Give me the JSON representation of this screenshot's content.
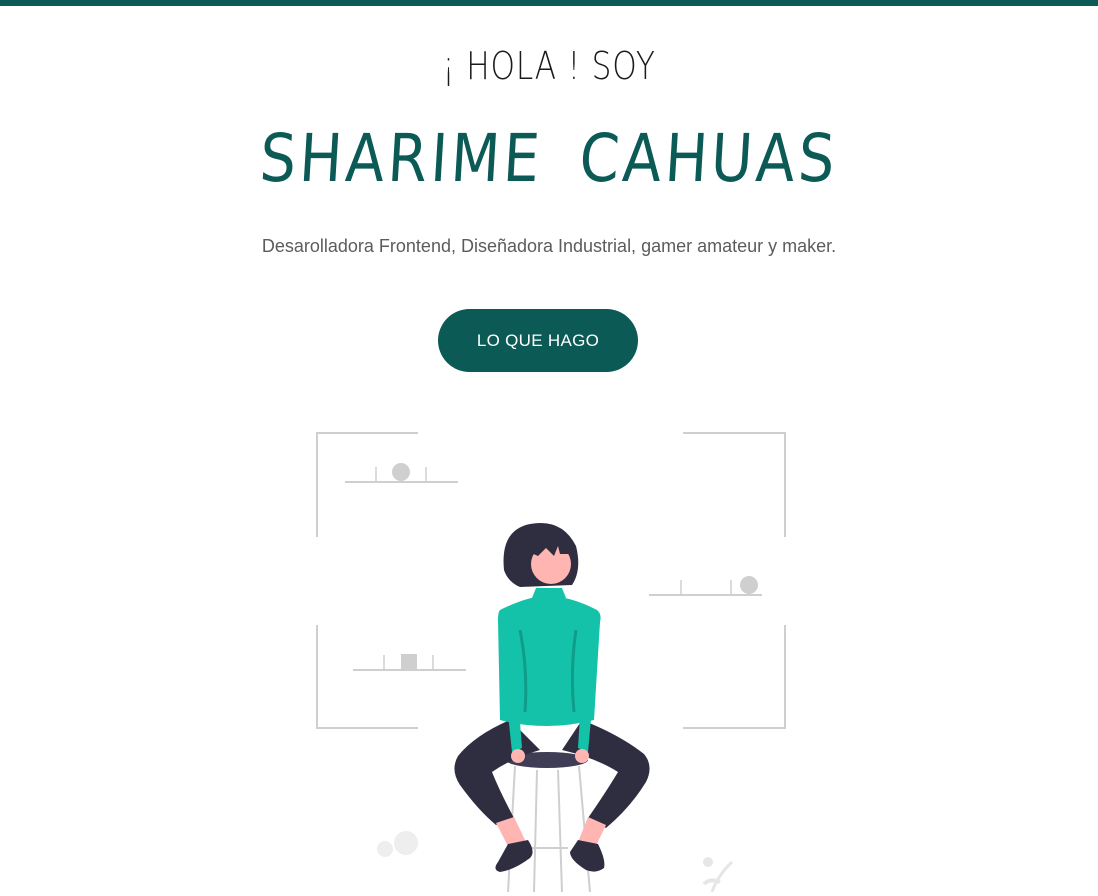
{
  "hero": {
    "greeting": "¡ HOLA ! SOY",
    "name": "SHARIME  CAHUAS",
    "tagline": "Desarolladora Frontend, Diseñadora Industrial, gamer amateur y maker.",
    "cta_label": "LO QUE HAGO"
  },
  "illustration": {
    "icon": "woman-on-stool-illustration"
  },
  "colors": {
    "brand": "#0b5a56",
    "shirt": "#14c2a9",
    "hair_pants": "#2f2e41",
    "skin": "#ffb6b3",
    "frame_gray": "#cfcfcf",
    "text_gray": "#5c5c5c"
  }
}
